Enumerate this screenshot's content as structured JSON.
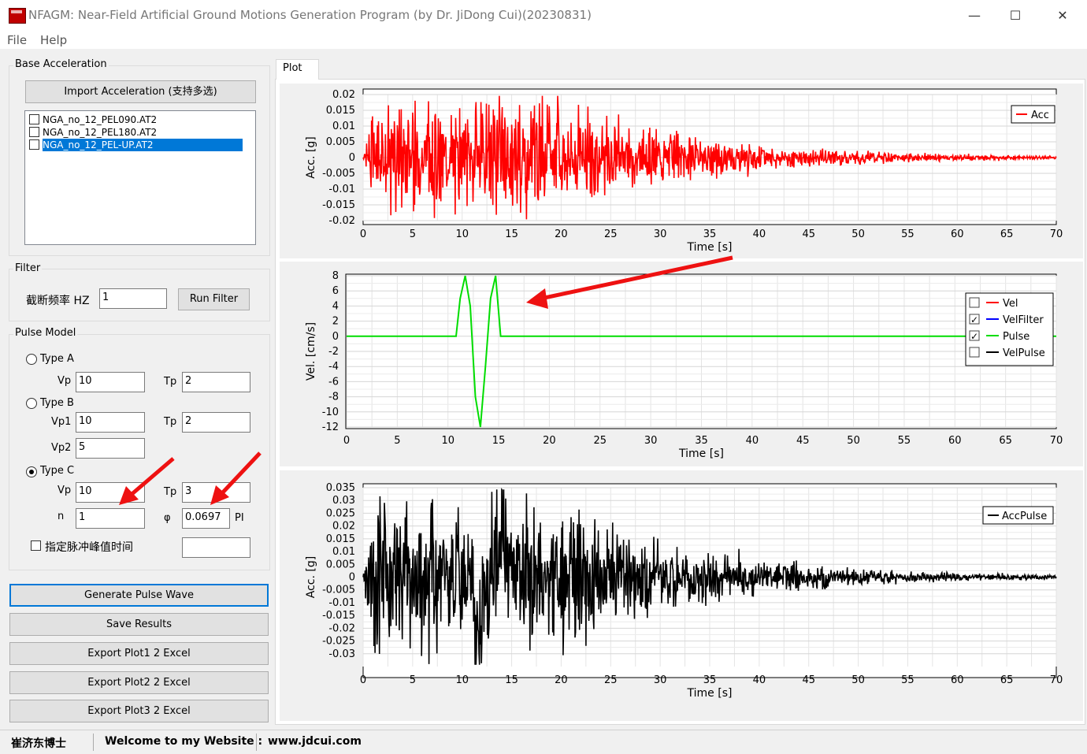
{
  "window": {
    "title": "NFAGM: Near-Field Artificial Ground Motions Generation Program (by Dr. JiDong Cui)(20230831)",
    "minimize": "—",
    "maximize": "☐",
    "close": "✕"
  },
  "menu": [
    "File",
    "Help"
  ],
  "base_acceleration": {
    "group_label": "Base Acceleration",
    "import_button": "Import Acceleration (支持多选)",
    "files": [
      {
        "name": "NGA_no_12_PEL090.AT2",
        "checked": false,
        "selected": false
      },
      {
        "name": "NGA_no_12_PEL180.AT2",
        "checked": false,
        "selected": false
      },
      {
        "name": "NGA_no_12_PEL-UP.AT2",
        "checked": false,
        "selected": true
      }
    ]
  },
  "filter": {
    "group_label": "Filter",
    "cutoff_label": "截断频率 HZ",
    "cutoff_value": "1",
    "run_button": "Run Filter"
  },
  "pulse_model": {
    "group_label": "Pulse Model",
    "type_a": {
      "label": "Type A",
      "selected": false,
      "vp_label": "Vp",
      "vp": "10",
      "tp_label": "Tp",
      "tp": "2"
    },
    "type_b": {
      "label": "Type B",
      "selected": false,
      "vp1_label": "Vp1",
      "vp1": "10",
      "tp_label": "Tp",
      "tp": "2",
      "vp2_label": "Vp2",
      "vp2": "5"
    },
    "type_c": {
      "label": "Type C",
      "selected": true,
      "vp_label": "Vp",
      "vp": "10",
      "tp_label": "Tp",
      "tp": "3",
      "n_label": "n",
      "n": "1",
      "phi_label": "φ",
      "phi": "0.0697",
      "phi_unit": "PI"
    },
    "peak_time_label": "指定脉冲峰值时间",
    "peak_time_checked": false,
    "peak_time_value": ""
  },
  "actions": {
    "generate": "Generate Pulse Wave",
    "save": "Save Results",
    "export1": "Export Plot1 2 Excel",
    "export2": "Export Plot2 2 Excel",
    "export3": "Export Plot3 2 Excel"
  },
  "tab": {
    "label": "Plot"
  },
  "status": {
    "author": "崔济东博士",
    "welcome": "Welcome to my Website :",
    "url": "www.jdcui.com"
  },
  "colors": {
    "acc": "#ff0000",
    "vel": "#ff0000",
    "velfilter": "#0000ff",
    "pulse": "#00dd00",
    "velpulse": "#000000",
    "accpulse": "#000000",
    "accent": "#0078d7"
  },
  "chart_data": [
    {
      "type": "line",
      "xlabel": "Time [s]",
      "ylabel": "Acc. [g]",
      "xlim": [
        0,
        70
      ],
      "ylim": [
        -0.02,
        0.02
      ],
      "xticks": [
        "0",
        "5",
        "10",
        "15",
        "20",
        "25",
        "30",
        "35",
        "40",
        "45",
        "50",
        "55",
        "60",
        "65",
        "70"
      ],
      "yticks": [
        "0.02",
        "0.015",
        "0.01",
        "0.005",
        "0",
        "-0.005",
        "-0.01",
        "-0.015",
        "-0.02"
      ],
      "grid": true,
      "legend_position": "top-right",
      "series": [
        {
          "name": "Acc",
          "color": "#ff0000",
          "peak_abs": 0.021,
          "peak_time": 18,
          "x_end": 70
        }
      ]
    },
    {
      "type": "line",
      "xlabel": "Time [s]",
      "ylabel": "Vel. [cm/s]",
      "xlim": [
        0,
        70
      ],
      "ylim": [
        -12,
        8
      ],
      "xticks": [
        "0",
        "5",
        "10",
        "15",
        "20",
        "25",
        "30",
        "35",
        "40",
        "45",
        "50",
        "55",
        "60",
        "65",
        "70"
      ],
      "yticks": [
        "8",
        "6",
        "4",
        "2",
        "0",
        "-2",
        "-4",
        "-6",
        "-8",
        "-10",
        "-12"
      ],
      "grid": true,
      "legend_position": "right",
      "legend": [
        {
          "name": "Vel",
          "checked": false
        },
        {
          "name": "VelFilter",
          "checked": true
        },
        {
          "name": "Pulse",
          "checked": true
        },
        {
          "name": "VelPulse",
          "checked": false
        }
      ],
      "series": [
        {
          "name": "Pulse",
          "color": "#00dd00",
          "x": [
            0,
            10.8,
            11.2,
            11.7,
            12.2,
            12.7,
            13.2,
            13.7,
            14.2,
            14.7,
            15.2,
            70
          ],
          "y": [
            0,
            0,
            5.0,
            8.0,
            4.0,
            -8.0,
            -12.0,
            -4.0,
            5.0,
            8.0,
            0,
            0
          ]
        }
      ]
    },
    {
      "type": "line",
      "xlabel": "Time [s]",
      "ylabel": "Acc. [g]",
      "xlim": [
        0,
        70
      ],
      "ylim": [
        -0.035,
        0.035
      ],
      "xticks": [
        "0",
        "5",
        "10",
        "15",
        "20",
        "25",
        "30",
        "35",
        "40",
        "45",
        "50",
        "55",
        "60",
        "65",
        "70"
      ],
      "yticks": [
        "0.035",
        "0.03",
        "0.025",
        "0.02",
        "0.015",
        "0.01",
        "0.005",
        "0",
        "-0.005",
        "-0.01",
        "-0.015",
        "-0.02",
        "-0.025",
        "-0.03"
      ],
      "grid": true,
      "legend_position": "top-right",
      "series": [
        {
          "name": "AccPulse",
          "color": "#000000",
          "peak_abs": 0.035,
          "peak_time": 13.8,
          "x_end": 70
        }
      ]
    }
  ]
}
